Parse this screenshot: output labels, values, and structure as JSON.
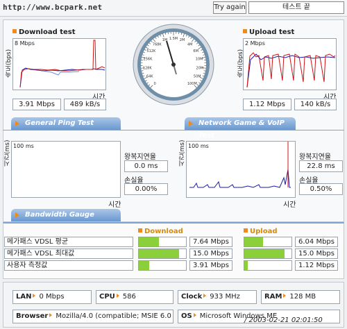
{
  "topbar": {
    "url": "http://www.bcpark.net",
    "try_again": "Try again",
    "test_end": "테스트 끝"
  },
  "download": {
    "title": "Download test",
    "ylabel": "속도(bps)",
    "scale": "8 Mbps",
    "xlabel": "시간",
    "mbps": "3.91 Mbps",
    "kbs": "489 kB/s"
  },
  "upload": {
    "title": "Upload test",
    "ylabel": "속도(bps)",
    "scale": "2 Mbps",
    "xlabel": "시간",
    "mbps": "1.12 Mbps",
    "kbs": "140 kB/s"
  },
  "gauge": {
    "marks": [
      "0",
      "64K",
      "128K",
      "256K",
      "512K",
      "768K",
      "1M",
      "1.5M",
      "2M",
      "4M",
      "6M",
      "10M",
      "20M",
      "50M",
      "100M"
    ]
  },
  "tabs": {
    "ping": "General Ping Test",
    "game": "Network Game & VoIP Test",
    "bandwidth": "Bandwidth Gauge"
  },
  "ping": {
    "ylabel": "시간(ms)",
    "scale": "100 ms",
    "xlabel": "시간",
    "rtt_label": "왕복지연율",
    "rtt": "0.0 ms",
    "loss_label": "손실율",
    "loss": "0.00%"
  },
  "game": {
    "ylabel": "시간(ms)",
    "scale": "100 ms",
    "xlabel": "시간",
    "rtt_label": "왕복지연율",
    "rtt": "22.8 ms",
    "loss_label": "손실율",
    "loss": "0.50%"
  },
  "bandwidth": {
    "download_header": "Download",
    "upload_header": "Upload",
    "rows": [
      {
        "label": "메가패스 VDSL 평균",
        "down": "7.64 Mbps",
        "down_fill": 0.42,
        "up": "6.04 Mbps",
        "up_fill": 0.4
      },
      {
        "label": "메가패스 VDSL 최대값",
        "down": "15.0 Mbps",
        "down_fill": 0.86,
        "up": "15.0 Mbps",
        "up_fill": 0.86
      },
      {
        "label": "사용자 측정값",
        "down": "3.91 Mbps",
        "down_fill": 0.22,
        "up": "1.12 Mbps",
        "up_fill": 0.08
      }
    ]
  },
  "sysinfo": {
    "lan_label": "LAN",
    "lan": "0 Mbps",
    "cpu_label": "CPU",
    "cpu": "586",
    "clock_label": "Clock",
    "clock": "933 MHz",
    "ram_label": "RAM",
    "ram": "128 MB",
    "browser_label": "Browser",
    "browser": "Mozilla/4.0 (compatible; MSIE 6.0",
    "os_label": "OS",
    "os": "Microsoft Windows ME"
  },
  "signature": "/ 2003-02-21 02:01:50",
  "colors": {
    "accent": "#f08a1e",
    "tab": "#6a98cf",
    "bar": "#8bd03a",
    "line_red": "#cc1111",
    "line_blue": "#1a1aa8"
  }
}
